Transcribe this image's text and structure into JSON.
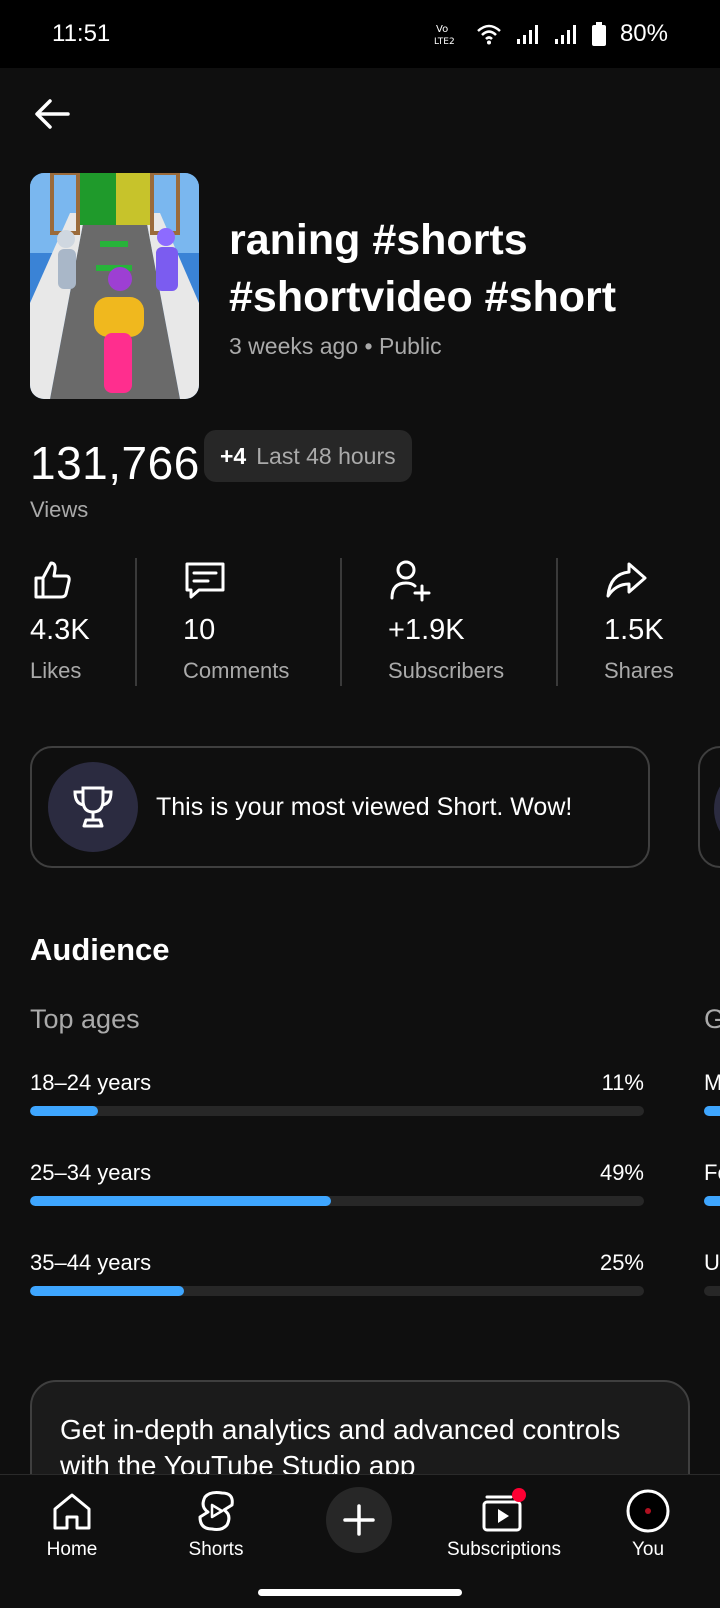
{
  "status_bar": {
    "time": "11:51",
    "battery": "80%"
  },
  "video": {
    "title": "raning #shorts #shortvideo #short #…",
    "meta": "3 weeks ago • Public"
  },
  "views": {
    "count": "131,766",
    "delta": "+4",
    "period": "Last 48 hours",
    "label": "Views"
  },
  "stats": [
    {
      "value": "4.3K",
      "label": "Likes",
      "icon": "thumb-up-icon"
    },
    {
      "value": "10",
      "label": "Comments",
      "icon": "comment-icon"
    },
    {
      "value": "+1.9K",
      "label": "Subscribers",
      "icon": "add-person-icon"
    },
    {
      "value": "1.5K",
      "label": "Shares",
      "icon": "share-icon"
    }
  ],
  "milestone": {
    "text": "This is your most viewed Short. Wow!",
    "icon": "trophy-icon"
  },
  "audience": {
    "title": "Audience",
    "top_ages_title": "Top ages",
    "gender_title_partial": "G",
    "ages": [
      {
        "label": "18–24 years",
        "pct": "11%",
        "fraction": 0.11
      },
      {
        "label": "25–34 years",
        "pct": "49%",
        "fraction": 0.49
      },
      {
        "label": "35–44 years",
        "pct": "25%",
        "fraction": 0.25
      }
    ],
    "gender_partial": [
      {
        "label": "M",
        "fraction": 0.8
      },
      {
        "label": "Fe",
        "fraction": 0.2
      },
      {
        "label": "U",
        "fraction": 0.0
      }
    ]
  },
  "promo": {
    "text": "Get in-depth analytics and advanced controls with the YouTube Studio app"
  },
  "nav": {
    "home": "Home",
    "shorts": "Shorts",
    "subscriptions": "Subscriptions",
    "you": "You"
  },
  "colors": {
    "accent": "#3ea6ff",
    "background": "#0f0f0f",
    "notification": "#ff0033"
  }
}
